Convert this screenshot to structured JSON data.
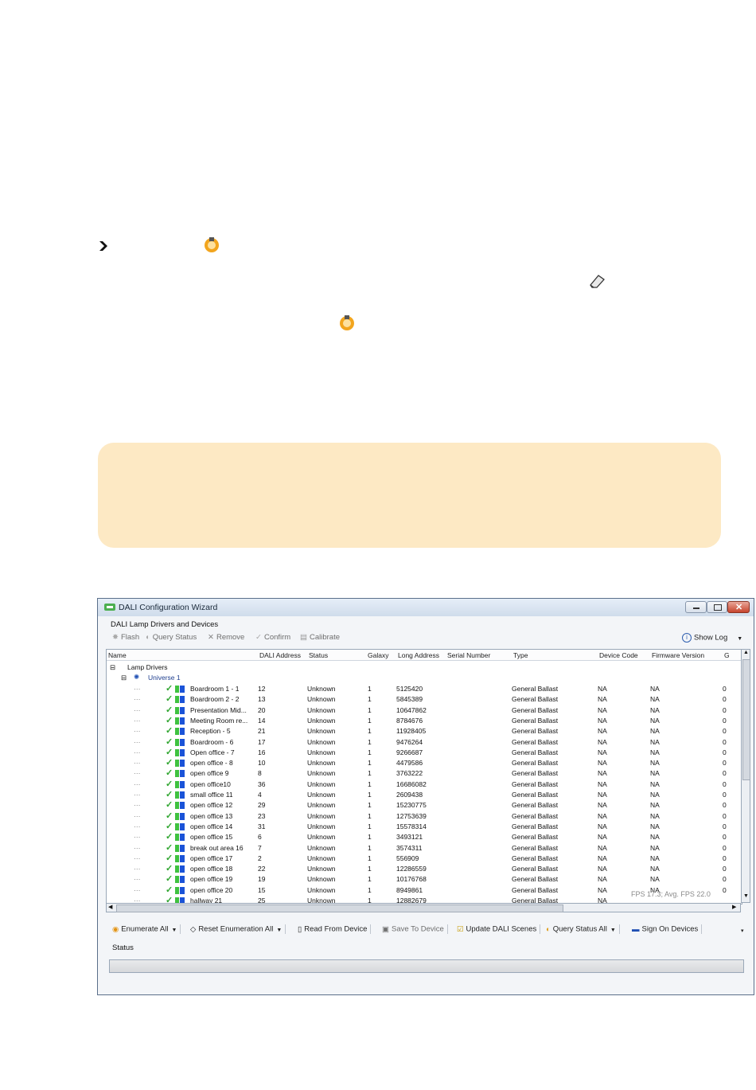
{
  "window": {
    "title": "DALI Configuration Wizard",
    "group_label": "DALI Lamp Drivers and Devices",
    "status_label": "Status",
    "fps_text": "FPS 17.3; Avg. FPS 22.0"
  },
  "toolbar_top": {
    "flash": "Flash",
    "query_status": "Query Status",
    "remove": "Remove",
    "confirm": "Confirm",
    "calibrate": "Calibrate",
    "show_log": "Show Log"
  },
  "columns": [
    "Name",
    "DALI Address",
    "Status",
    "Galaxy",
    "Long Address",
    "Serial Number",
    "Type",
    "Device Code",
    "Firmware Version",
    "G"
  ],
  "tree": {
    "root": "Lamp Drivers",
    "universe": "Universe 1"
  },
  "rows": [
    {
      "name": "Boardroom 1 - 1",
      "addr": "12",
      "status": "Unknown",
      "galaxy": "1",
      "long": "5125420",
      "type": "General Ballast",
      "code": "NA",
      "fw": "NA",
      "g": "0"
    },
    {
      "name": "Boardroom 2 - 2",
      "addr": "13",
      "status": "Unknown",
      "galaxy": "1",
      "long": "5845389",
      "type": "General Ballast",
      "code": "NA",
      "fw": "NA",
      "g": "0"
    },
    {
      "name": "Presentation Mid...",
      "addr": "20",
      "status": "Unknown",
      "galaxy": "1",
      "long": "10647862",
      "type": "General Ballast",
      "code": "NA",
      "fw": "NA",
      "g": "0"
    },
    {
      "name": "Meeting Room re...",
      "addr": "14",
      "status": "Unknown",
      "galaxy": "1",
      "long": "8784676",
      "type": "General Ballast",
      "code": "NA",
      "fw": "NA",
      "g": "0"
    },
    {
      "name": "Reception - 5",
      "addr": "21",
      "status": "Unknown",
      "galaxy": "1",
      "long": "11928405",
      "type": "General Ballast",
      "code": "NA",
      "fw": "NA",
      "g": "0"
    },
    {
      "name": "Boardroom - 6",
      "addr": "17",
      "status": "Unknown",
      "galaxy": "1",
      "long": "9476264",
      "type": "General Ballast",
      "code": "NA",
      "fw": "NA",
      "g": "0"
    },
    {
      "name": "Open office - 7",
      "addr": "16",
      "status": "Unknown",
      "galaxy": "1",
      "long": "9266687",
      "type": "General Ballast",
      "code": "NA",
      "fw": "NA",
      "g": "0"
    },
    {
      "name": "open office - 8",
      "addr": "10",
      "status": "Unknown",
      "galaxy": "1",
      "long": "4479586",
      "type": "General Ballast",
      "code": "NA",
      "fw": "NA",
      "g": "0"
    },
    {
      "name": "open office 9",
      "addr": "8",
      "status": "Unknown",
      "galaxy": "1",
      "long": "3763222",
      "type": "General Ballast",
      "code": "NA",
      "fw": "NA",
      "g": "0"
    },
    {
      "name": "open office10",
      "addr": "36",
      "status": "Unknown",
      "galaxy": "1",
      "long": "16686082",
      "type": "General Ballast",
      "code": "NA",
      "fw": "NA",
      "g": "0"
    },
    {
      "name": "small office 11",
      "addr": "4",
      "status": "Unknown",
      "galaxy": "1",
      "long": "2609438",
      "type": "General Ballast",
      "code": "NA",
      "fw": "NA",
      "g": "0"
    },
    {
      "name": "open office 12",
      "addr": "29",
      "status": "Unknown",
      "galaxy": "1",
      "long": "15230775",
      "type": "General Ballast",
      "code": "NA",
      "fw": "NA",
      "g": "0"
    },
    {
      "name": "open office 13",
      "addr": "23",
      "status": "Unknown",
      "galaxy": "1",
      "long": "12753639",
      "type": "General Ballast",
      "code": "NA",
      "fw": "NA",
      "g": "0"
    },
    {
      "name": "open office 14",
      "addr": "31",
      "status": "Unknown",
      "galaxy": "1",
      "long": "15578314",
      "type": "General Ballast",
      "code": "NA",
      "fw": "NA",
      "g": "0"
    },
    {
      "name": "open office 15",
      "addr": "6",
      "status": "Unknown",
      "galaxy": "1",
      "long": "3493121",
      "type": "General Ballast",
      "code": "NA",
      "fw": "NA",
      "g": "0"
    },
    {
      "name": "break out area 16",
      "addr": "7",
      "status": "Unknown",
      "galaxy": "1",
      "long": "3574311",
      "type": "General Ballast",
      "code": "NA",
      "fw": "NA",
      "g": "0"
    },
    {
      "name": "open office 17",
      "addr": "2",
      "status": "Unknown",
      "galaxy": "1",
      "long": "556909",
      "type": "General Ballast",
      "code": "NA",
      "fw": "NA",
      "g": "0"
    },
    {
      "name": "open office 18",
      "addr": "22",
      "status": "Unknown",
      "galaxy": "1",
      "long": "12286559",
      "type": "General Ballast",
      "code": "NA",
      "fw": "NA",
      "g": "0"
    },
    {
      "name": "open office 19",
      "addr": "19",
      "status": "Unknown",
      "galaxy": "1",
      "long": "10176768",
      "type": "General Ballast",
      "code": "NA",
      "fw": "NA",
      "g": "0"
    },
    {
      "name": "open office 20",
      "addr": "15",
      "status": "Unknown",
      "galaxy": "1",
      "long": "8949861",
      "type": "General Ballast",
      "code": "NA",
      "fw": "NA",
      "g": "0"
    },
    {
      "name": "hallway 21",
      "addr": "25",
      "status": "Unknown",
      "galaxy": "1",
      "long": "12882679",
      "type": "General Ballast",
      "code": "NA",
      "fw": "",
      "g": ""
    }
  ],
  "toolbar_bottom": {
    "enumerate_all": "Enumerate All",
    "reset_enumeration_all": "Reset Enumeration All",
    "read_from_device": "Read From Device",
    "save_to_device": "Save To Device",
    "update_dali_scenes": "Update DALI Scenes",
    "query_status_all": "Query Status All",
    "sign_on_devices": "Sign On Devices"
  },
  "colors": {
    "note_background": "#fde9c4",
    "check_green": "#2fa52f",
    "square_green": "#3fc23f",
    "square_blue": "#1a53d8"
  }
}
